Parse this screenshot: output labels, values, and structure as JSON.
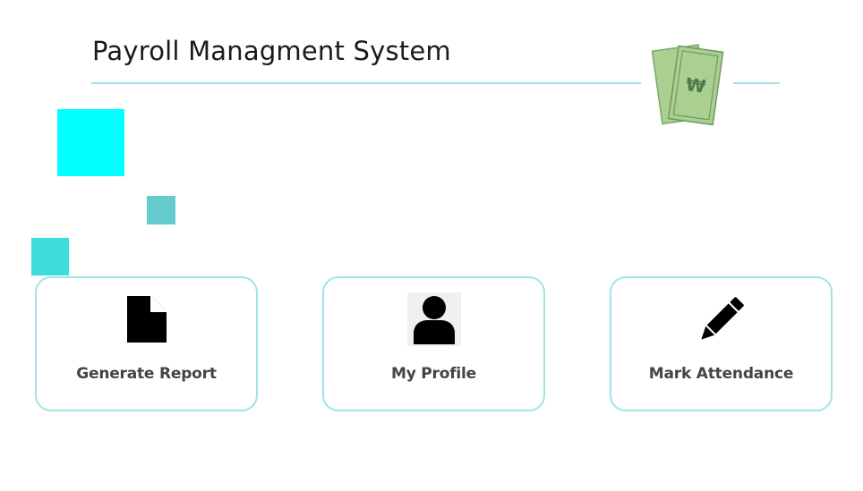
{
  "header": {
    "title": "Payroll Managment System"
  },
  "cards": [
    {
      "label": "Generate Report",
      "icon": "document-icon"
    },
    {
      "label": "My Profile",
      "icon": "user-icon"
    },
    {
      "label": "Mark Attendance",
      "icon": "pencil-icon"
    }
  ],
  "colors": {
    "accent": "#9fe4e4",
    "deco_cyan": "#00ffff",
    "deco_teal": "#64cccc",
    "deco_turquoise": "#3ddcdc",
    "money_green": "#a9cf91",
    "money_dark": "#5a8a52"
  }
}
